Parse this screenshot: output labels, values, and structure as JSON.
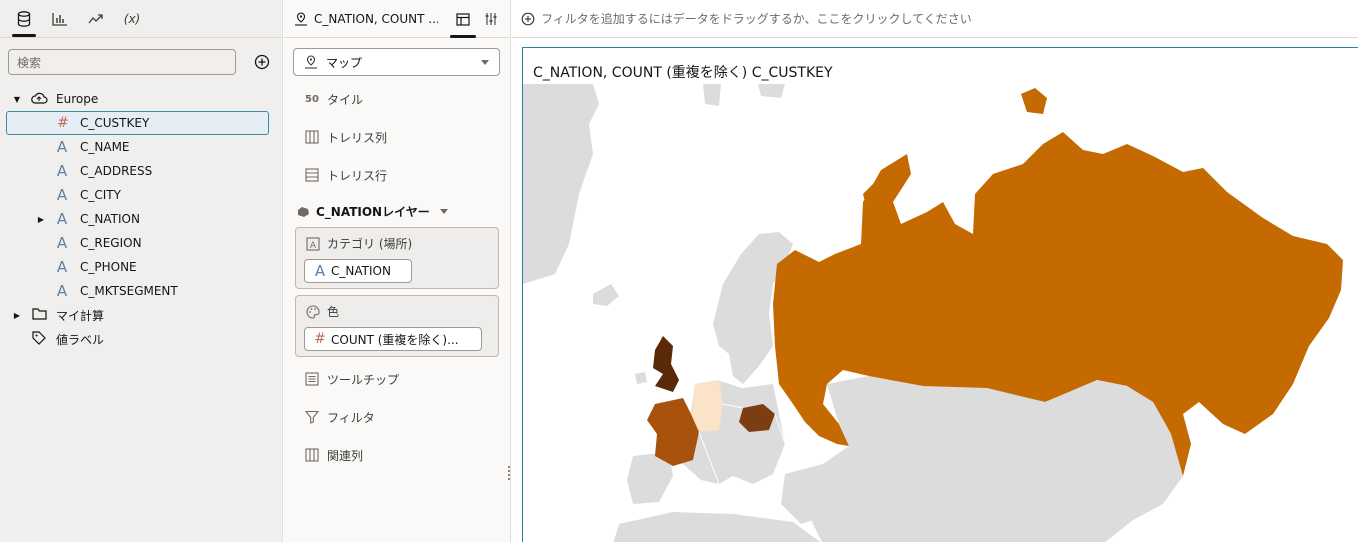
{
  "left_panel": {
    "search_placeholder": "検索",
    "tree": {
      "root": "Europe",
      "columns": [
        {
          "label": "C_CUSTKEY",
          "type": "number",
          "selected": true
        },
        {
          "label": "C_NAME",
          "type": "attribute"
        },
        {
          "label": "C_ADDRESS",
          "type": "attribute"
        },
        {
          "label": "C_CITY",
          "type": "attribute"
        },
        {
          "label": "C_NATION",
          "type": "attribute",
          "expandable": true
        },
        {
          "label": "C_REGION",
          "type": "attribute"
        },
        {
          "label": "C_PHONE",
          "type": "attribute"
        },
        {
          "label": "C_MKTSEGMENT",
          "type": "attribute"
        }
      ],
      "my_calculations": "マイ計算",
      "value_labels": "値ラベル"
    },
    "tabs": [
      "data-icon",
      "chart-icon",
      "trend-icon",
      "function-icon"
    ],
    "function_tab_label": "(x)"
  },
  "grammar_panel": {
    "header_title": "C_NATION, COUNT ...",
    "viz_type": "マップ",
    "rows": {
      "tile": "タイル",
      "tile_icon_text": "50",
      "trellis_columns": "トレリス列",
      "trellis_rows": "トレリス行"
    },
    "layer": "C_NATIONレイヤー",
    "category_title": "カテゴリ (場所)",
    "category_chip": "C_NATION",
    "color_title": "色",
    "color_chip": "COUNT (重複を除く)...",
    "tooltip": "ツールチップ",
    "filter": "フィルタ",
    "related": "関連列"
  },
  "canvas": {
    "filter_hint": "フィルタを追加するにはデータをドラッグするか、ここをクリックしてください",
    "viz_title": "C_NATION, COUNT (重複を除く) C_CUSTKEY"
  },
  "colors": {
    "accent": "#2b7fa6",
    "russia": "#c46a00",
    "france": "#a8520e",
    "romania": "#7a3e10",
    "uk": "#5a2a08",
    "germany": "#fbe3c8",
    "land": "#dcdcdc",
    "water": "#ffffff"
  }
}
